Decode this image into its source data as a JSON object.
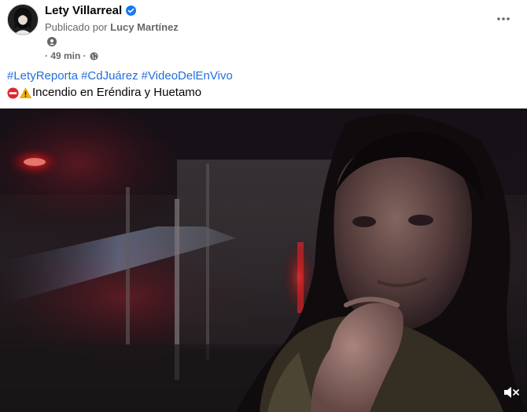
{
  "post": {
    "author": "Lety Villarreal",
    "published_prefix": "Publicado por",
    "publisher": "Lucy Martínez",
    "time": "· 49 min ·",
    "hashtags": [
      "#LetyReporta",
      "#CdJuárez",
      "#VideoDelEnVivo"
    ],
    "caption": "Incendio en Eréndira y Huetamo"
  },
  "colors": {
    "link": "#216fdb",
    "secondary_text": "#65676b",
    "verified": "#1877f2"
  },
  "icons": [
    "avatar",
    "verified-badge-icon",
    "role-icon",
    "globe-icon",
    "more-options-icon",
    "no-entry-icon",
    "warning-icon",
    "volume-muted-icon"
  ]
}
